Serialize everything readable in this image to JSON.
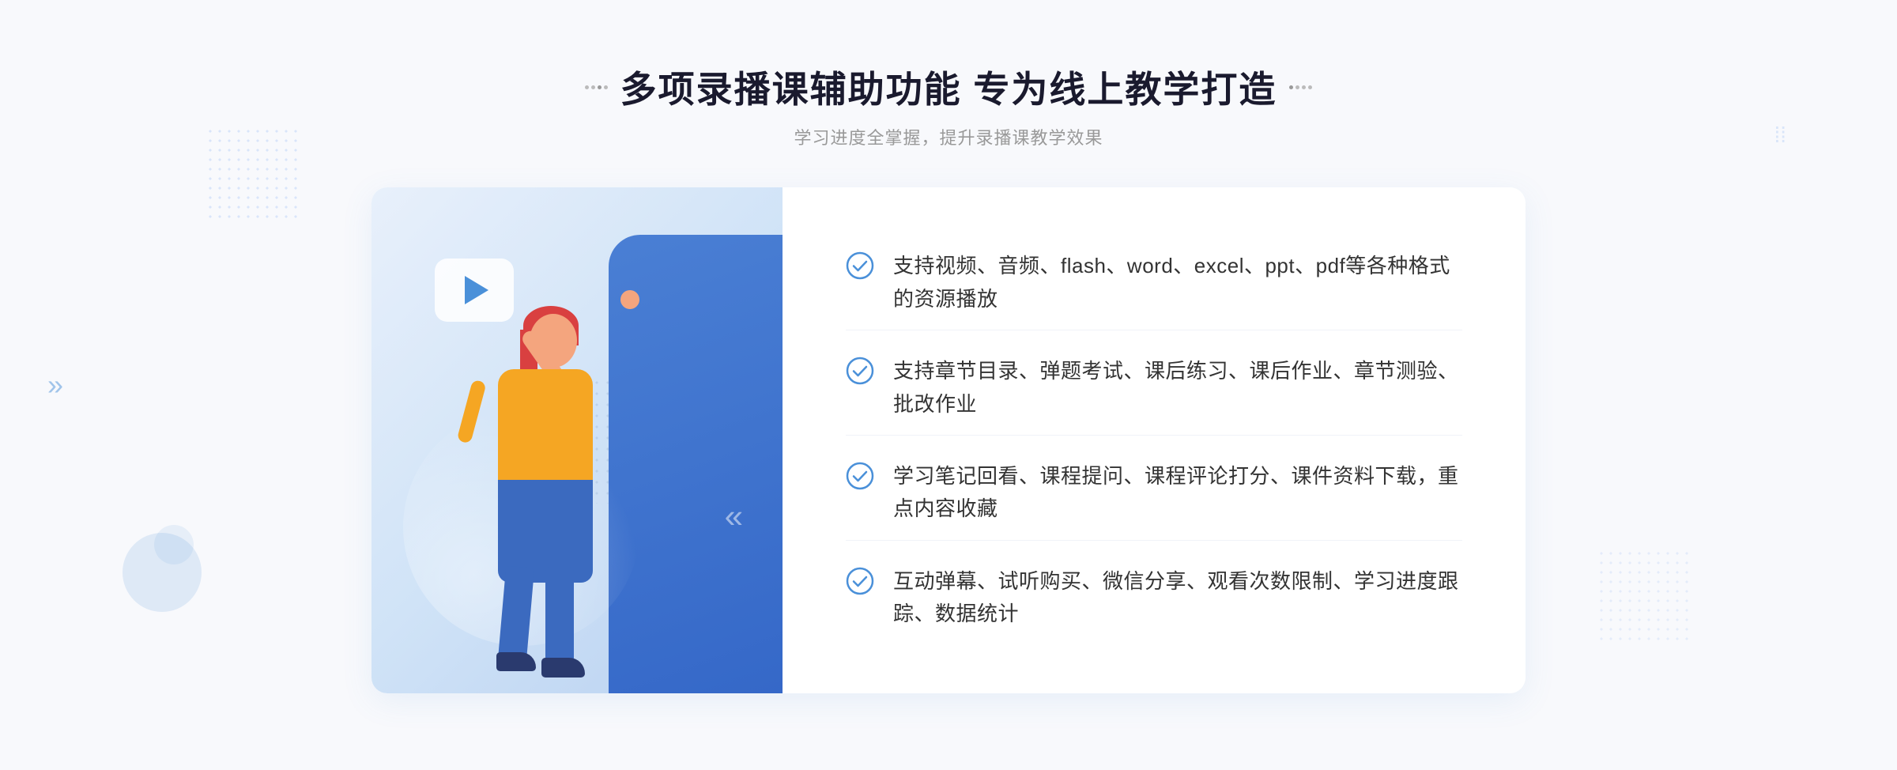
{
  "page": {
    "background_color": "#f8f9fc"
  },
  "header": {
    "title": "多项录播课辅助功能 专为线上教学打造",
    "subtitle": "学习进度全掌握，提升录播课教学效果"
  },
  "features": [
    {
      "id": 1,
      "text": "支持视频、音频、flash、word、excel、ppt、pdf等各种格式的资源播放"
    },
    {
      "id": 2,
      "text": "支持章节目录、弹题考试、课后练习、课后作业、章节测验、批改作业"
    },
    {
      "id": 3,
      "text": "学习笔记回看、课程提问、课程评论打分、课件资料下载，重点内容收藏"
    },
    {
      "id": 4,
      "text": "互动弹幕、试听购买、微信分享、观看次数限制、学习进度跟踪、数据统计"
    }
  ],
  "colors": {
    "primary_blue": "#4a7fd4",
    "check_color": "#4a90d9",
    "title_color": "#1a1a2e",
    "text_color": "#333333",
    "subtitle_color": "#999999"
  },
  "icons": {
    "check_circle": "check-circle-icon",
    "play": "play-icon",
    "chevron": "chevron-icon"
  }
}
